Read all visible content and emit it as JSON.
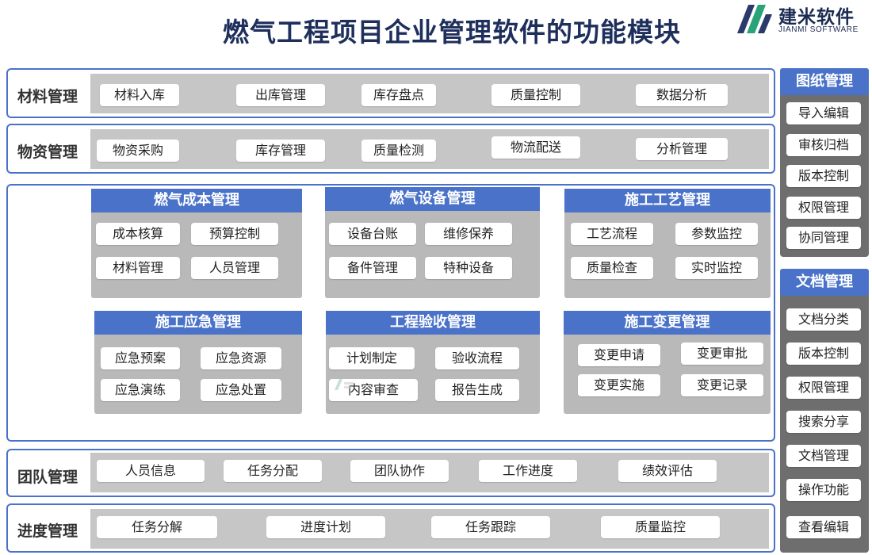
{
  "header": {
    "title": "燃气工程项目企业管理软件的功能模块"
  },
  "logo": {
    "name_cn": "建米软件",
    "name_en": "JIANMI SOFTWARE",
    "icon": "jianmi-logo-mark"
  },
  "rows": {
    "material": {
      "label": "材料管理",
      "items": [
        "材料入库",
        "出库管理",
        "库存盘点",
        "质量控制",
        "数据分析"
      ]
    },
    "supplies": {
      "label": "物资管理",
      "items": [
        "物资采购",
        "库存管理",
        "质量检测",
        "物流配送",
        "分析管理"
      ]
    },
    "team": {
      "label": "团队管理",
      "items": [
        "人员信息",
        "任务分配",
        "团队协作",
        "工作进度",
        "绩效评估"
      ]
    },
    "progress": {
      "label": "进度管理",
      "items": [
        "任务分解",
        "进度计划",
        "任务跟踪",
        "质量监控"
      ]
    }
  },
  "cards": [
    {
      "title": "燃气成本管理",
      "items": [
        "成本核算",
        "预算控制",
        "材料管理",
        "人员管理"
      ]
    },
    {
      "title": "燃气设备管理",
      "items": [
        "设备台账",
        "维修保养",
        "备件管理",
        "特种设备"
      ]
    },
    {
      "title": "施工工艺管理",
      "items": [
        "工艺流程",
        "参数监控",
        "质量检查",
        "实时监控"
      ]
    },
    {
      "title": "施工应急管理",
      "items": [
        "应急预案",
        "应急资源",
        "应急演练",
        "应急处置"
      ]
    },
    {
      "title": "工程验收管理",
      "items": [
        "计划制定",
        "验收流程",
        "内容审查",
        "报告生成"
      ]
    },
    {
      "title": "施工变更管理",
      "items": [
        "变更申请",
        "变更审批",
        "变更实施",
        "变更记录"
      ]
    }
  ],
  "side": {
    "drawings": {
      "title": "图纸管理",
      "items": [
        "导入编辑",
        "审核归档",
        "版本控制",
        "权限管理",
        "协同管理"
      ]
    },
    "documents": {
      "title": "文档管理",
      "items": [
        "文档分类",
        "版本控制",
        "权限管理",
        "搜索分享",
        "文档管理",
        "操作功能",
        "查看编辑"
      ]
    }
  },
  "colors": {
    "accent": "#4a72c9",
    "track": "#c6c6c6",
    "card_body": "#b9b9b9",
    "side_body": "#6e6e6e",
    "title": "#1e2f5c"
  }
}
